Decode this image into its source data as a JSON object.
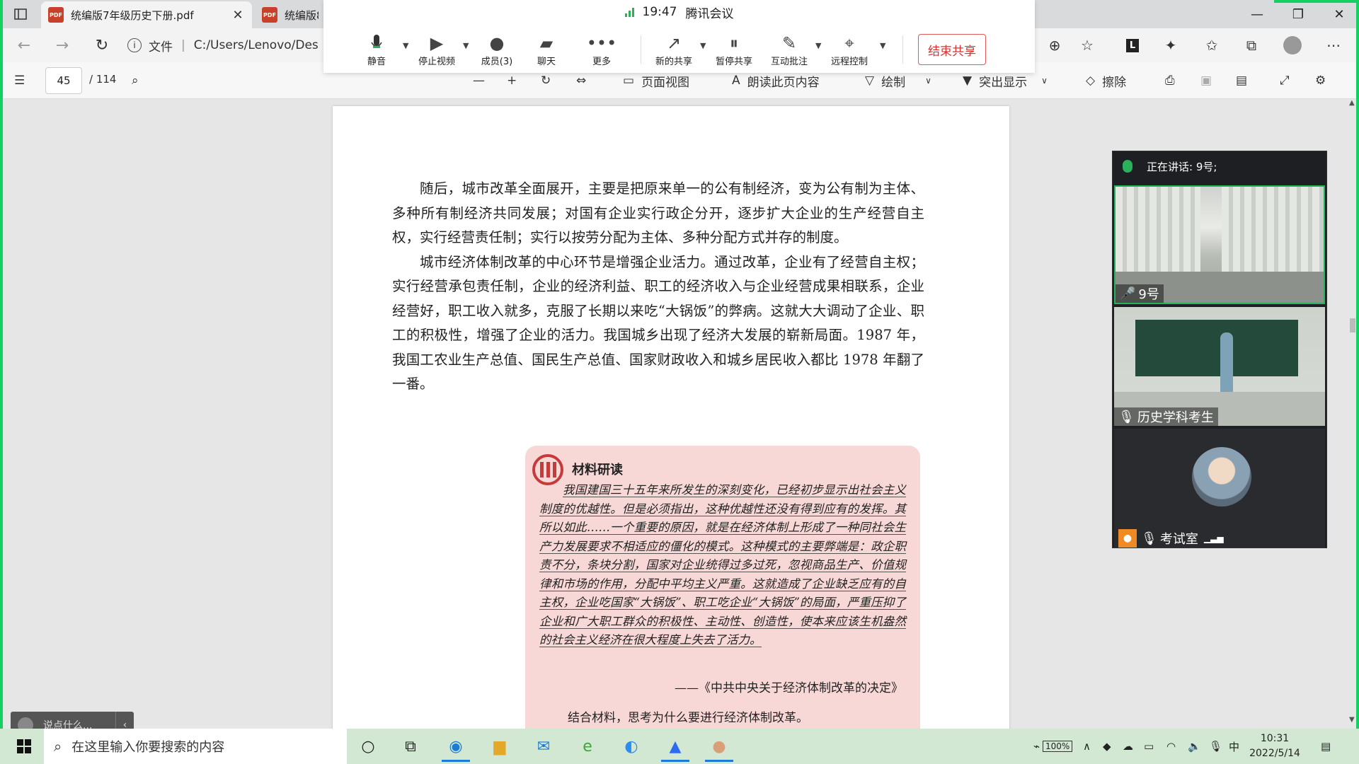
{
  "browser": {
    "tabs": [
      {
        "title": "统编版7年级历史下册.pdf",
        "active": true
      },
      {
        "title": "统编版8",
        "active": false
      }
    ],
    "address": {
      "label": "文件",
      "path": "C:/Users/Lenovo/Des"
    }
  },
  "pdf_toolbar": {
    "page_current": "45",
    "page_total": "/ 114",
    "page_view_label": "页面视图",
    "read_aloud_label": "朗读此页内容",
    "draw_label": "绘制",
    "highlight_label": "突出显示",
    "erase_label": "擦除"
  },
  "meeting": {
    "time": "19:47",
    "app_name": "腾讯会议",
    "buttons": {
      "mute": "静音",
      "stop_video": "停止视频",
      "members": "成员(3)",
      "chat": "聊天",
      "more": "更多",
      "new_share": "新的共享",
      "pause_share": "暂停共享",
      "annotate": "互动批注",
      "remote_control": "远程控制"
    },
    "end_share": "结束共享",
    "speaking": "正在讲话: 9号;",
    "participants": [
      "9号",
      "历史学科考生",
      "考试室"
    ],
    "chat_placeholder": "说点什么..."
  },
  "document": {
    "paragraph1": "随后，城市改革全面展开，主要是把原来单一的公有制经济，变为公有制为主体、多种所有制经济共同发展；对国有企业实行政企分开，逐步扩大企业的生产经营自主权，实行经营责任制；实行以按劳分配为主体、多种分配方式并存的制度。",
    "paragraph2": "城市经济体制改革的中心环节是增强企业活力。通过改革，企业有了经营自主权；实行经营承包责任制，企业的经济利益、职工的经济收入与企业经营成果相联系，企业经营好，职工收入就多，克服了长期以来吃“大锅饭”的弊病。这就大大调动了企业、职工的积极性，增强了企业的活力。我国城乡出现了经济大发展的崭新局面。1987 年，我国工农业生产总值、国民生产总值、国家财政收入和城乡居民收入都比 1978 年翻了一番。",
    "material": {
      "title": "材料研读",
      "text": "我国建国三十五年来所发生的深刻变化，已经初步显示出社会主义制度的优越性。但是必须指出，这种优越性还没有得到应有的发挥。其所以如此……一个重要的原因，就是在经济体制上形成了一种同社会生产力发展要求不相适应的僵化的模式。这种模式的主要弊端是：政企职责不分，条块分割，国家对企业统得过多过死，忽视商品生产、价值规律和市场的作用，分配中平均主义严重。这就造成了企业缺乏应有的自主权，企业吃国家“大锅饭”、职工吃企业“大锅饭”的局面，严重压抑了企业和广大职工群众的积极性、主动性、创造性，使本来应该生机盎然的社会主义经济在很大程度上失去了活力。",
      "source": "——《中共中央关于经济体制改革的决定》",
      "question": "结合材料，思考为什么要进行经济体制改革。"
    }
  },
  "taskbar": {
    "search_placeholder": "在这里输入你要搜索的内容",
    "battery": "100%",
    "ime": "中",
    "time": "10:31",
    "date": "2022/5/14"
  },
  "colors": {
    "accent_green": "#13d060",
    "end_share_red": "#d93030",
    "pdf_icon": "#c8402a"
  }
}
